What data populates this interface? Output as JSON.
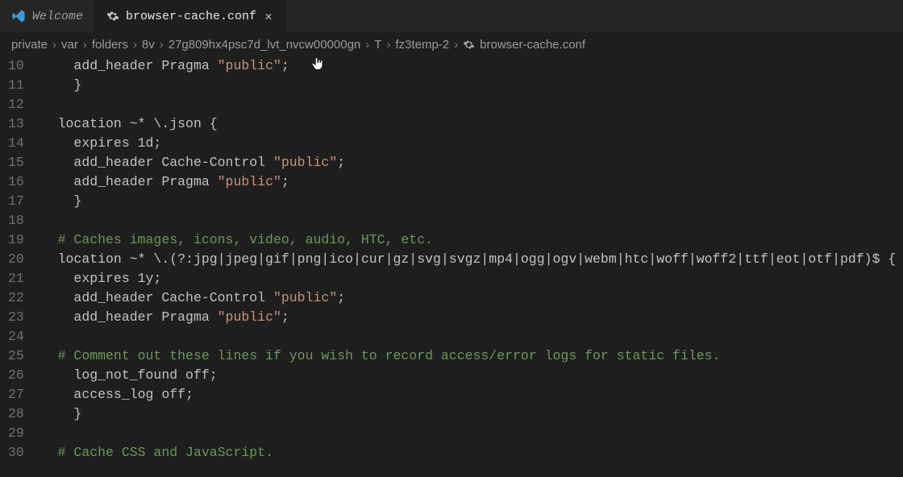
{
  "tabs": {
    "welcome": "Welcome",
    "file": "browser-cache.conf"
  },
  "breadcrumbs": {
    "p0": "private",
    "p1": "var",
    "p2": "folders",
    "p3": "8v",
    "p4": "27g809hx4psc7d_lvt_nvcw00000gn",
    "p5": "T",
    "p6": "fz3temp-2",
    "file": "browser-cache.conf"
  },
  "gutter": {
    "start": 10,
    "end": 30
  },
  "code": {
    "l10a": "    add_header Pragma ",
    "l10b": "\"public\"",
    "l10c": ";",
    "l11": "    }",
    "l12": "",
    "l13": "  location ~* \\.json {",
    "l14": "    expires 1d;",
    "l15a": "    add_header Cache-Control ",
    "l15b": "\"public\"",
    "l15c": ";",
    "l16a": "    add_header Pragma ",
    "l16b": "\"public\"",
    "l16c": ";",
    "l17": "    }",
    "l18": "",
    "l19": "  # Caches images, icons, video, audio, HTC, etc.",
    "l20": "  location ~* \\.(?:jpg|jpeg|gif|png|ico|cur|gz|svg|svgz|mp4|ogg|ogv|webm|htc|woff|woff2|ttf|eot|otf|pdf)$ {",
    "l21": "    expires 1y;",
    "l22a": "    add_header Cache-Control ",
    "l22b": "\"public\"",
    "l22c": ";",
    "l23a": "    add_header Pragma ",
    "l23b": "\"public\"",
    "l23c": ";",
    "l24": "",
    "l25": "  # Comment out these lines if you wish to record access/error logs for static files.",
    "l26": "    log_not_found off;",
    "l27": "    access_log off;",
    "l28": "    }",
    "l29": "",
    "l30": "  # Cache CSS and JavaScript."
  }
}
